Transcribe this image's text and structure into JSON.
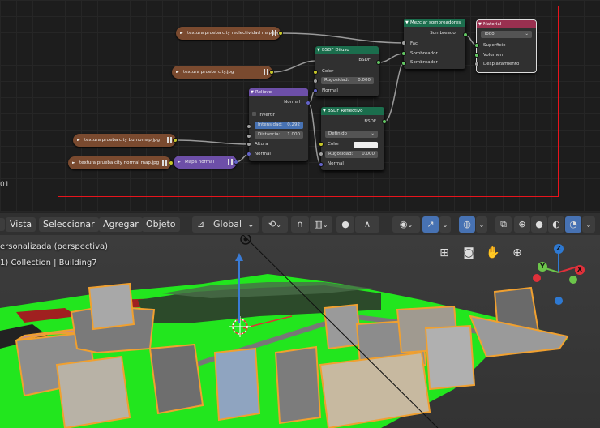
{
  "node_editor": {
    "frame_number": "01",
    "textures": [
      {
        "label": "textura prueba city reclectividad map.jpg"
      },
      {
        "label": "textura prueba city.jpg"
      },
      {
        "label": "textura prueba city bumpmap.jpg"
      },
      {
        "label": "textura prueba city normal map.jpg"
      }
    ],
    "normal_map": {
      "title": "Mapa normal"
    },
    "bump": {
      "title": "Relieve",
      "out_normal": "Normal",
      "invert": "Invertir",
      "strength_label": "Intensidad:",
      "strength_value": "0.292",
      "distance_label": "Distancia:",
      "distance_value": "1.000",
      "height": "Altura",
      "normal": "Normal"
    },
    "diffuse": {
      "title": "BSDF Difuso",
      "out": "BSDF",
      "color": "Color",
      "roughness_label": "Rugosidad:",
      "roughness_value": "0.000",
      "normal": "Normal"
    },
    "glossy": {
      "title": "BSDF Reflectivo",
      "out": "BSDF",
      "distribution": "Definido",
      "color": "Color",
      "roughness_label": "Rugosidad:",
      "roughness_value": "0.000",
      "normal": "Normal"
    },
    "mix": {
      "title": "Mezclar sombreadores",
      "out": "Sombreador",
      "fac": "Fac",
      "shader1": "Sombreador",
      "shader2": "Sombreador"
    },
    "output": {
      "title": "Material",
      "target": "Todo",
      "surface": "Superficie",
      "volume": "Volumen",
      "displacement": "Desplazamiento"
    }
  },
  "toolbar": {
    "view": "Vista",
    "select": "Seleccionar",
    "add": "Agregar",
    "object": "Objeto",
    "orientation": "Global"
  },
  "viewport": {
    "view_name": "ersonalizada (perspectiva)",
    "collection": "1) Collection | Building7",
    "gizmo": {
      "z": "Z",
      "y": "Y",
      "x": "X"
    },
    "colors": {
      "ground": "#22e61e",
      "selection": "#f0a030"
    }
  }
}
